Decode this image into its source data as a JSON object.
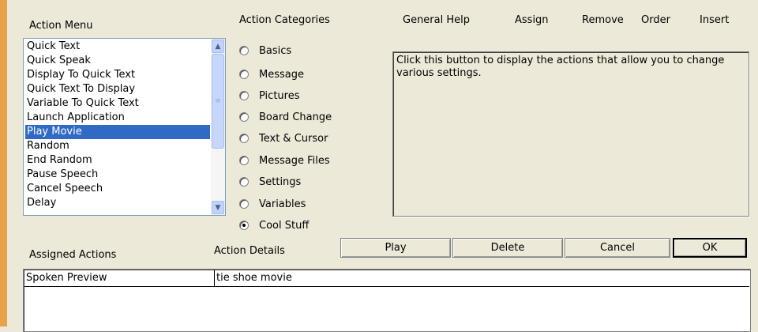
{
  "action_menu": {
    "label": "Action Menu",
    "items": [
      "Quick Text",
      "Quick Speak",
      "Display To Quick Text",
      "Quick Text To Display",
      "Variable To Quick Text",
      "Launch Application",
      "Play Movie",
      "Random",
      "End Random",
      "Pause Speech",
      "Cancel Speech",
      "Delay"
    ],
    "selected": "Play Movie"
  },
  "categories": {
    "label": "Action Categories",
    "options": [
      "Basics",
      "Message",
      "Pictures",
      "Board Change",
      "Text & Cursor",
      "Message Files",
      "Settings",
      "Variables",
      "Cool Stuff"
    ],
    "selected": "Cool Stuff"
  },
  "header_links": {
    "general_help": "General Help",
    "assign": "Assign",
    "remove": "Remove",
    "order": "Order",
    "insert": "Insert"
  },
  "help_text": "Click this button to display the actions that allow you to change various settings.",
  "assigned": {
    "label": "Assigned Actions",
    "details_label": "Action Details",
    "rows": [
      {
        "action": "Spoken Preview",
        "details": "tie shoe movie"
      }
    ]
  },
  "buttons": {
    "play": "Play",
    "delete": "Delete",
    "cancel": "Cancel",
    "ok": "OK"
  },
  "colors": {
    "window_bg": "#ece9d8",
    "selection": "#316ac5",
    "accent_edge": "#e7a24a"
  }
}
